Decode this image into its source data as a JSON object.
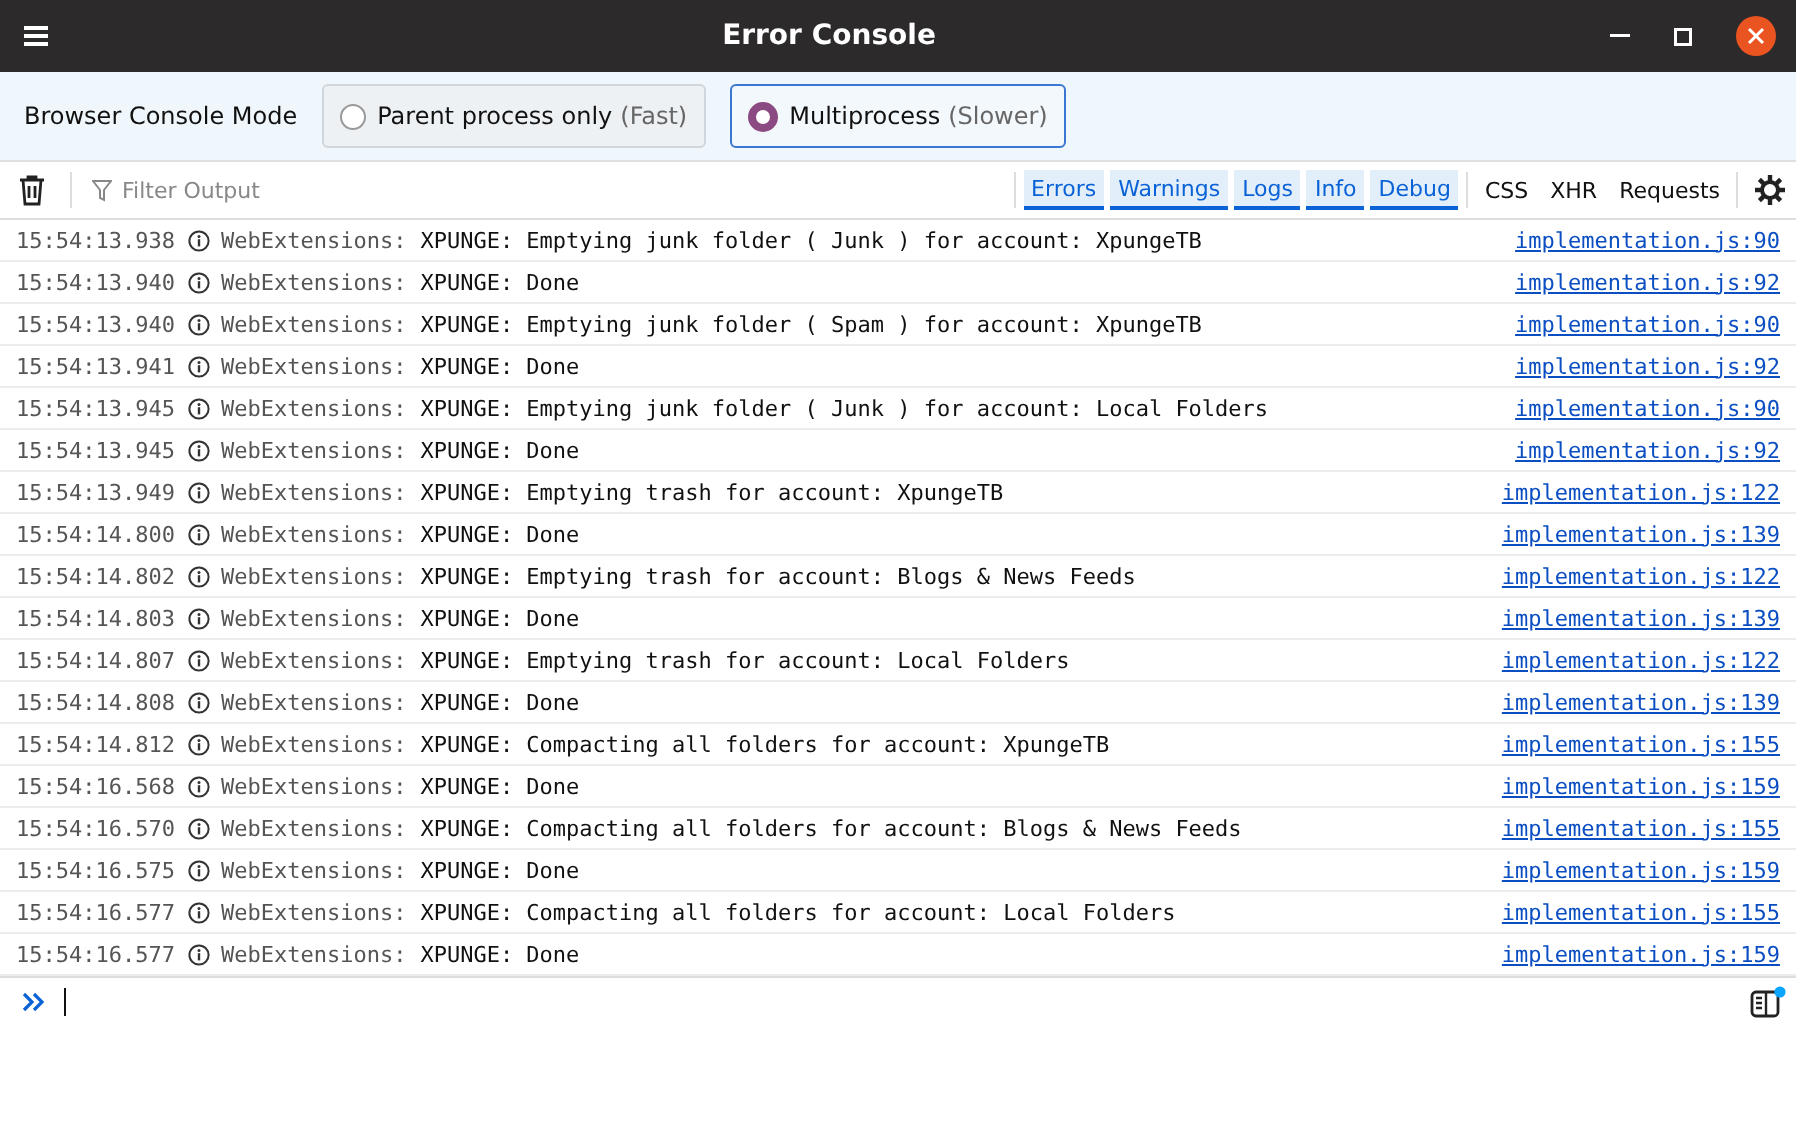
{
  "window": {
    "title": "Error Console"
  },
  "mode": {
    "label": "Browser Console Mode",
    "options": [
      {
        "label": "Parent process only",
        "note": "(Fast)",
        "selected": false
      },
      {
        "label": "Multiprocess",
        "note": "(Slower)",
        "selected": true
      }
    ]
  },
  "toolbar": {
    "filter_placeholder": "Filter Output",
    "filters": [
      {
        "label": "Errors",
        "selected": true
      },
      {
        "label": "Warnings",
        "selected": true
      },
      {
        "label": "Logs",
        "selected": true
      },
      {
        "label": "Info",
        "selected": true
      },
      {
        "label": "Debug",
        "selected": true
      },
      {
        "label": "CSS",
        "selected": false
      },
      {
        "label": "XHR",
        "selected": false
      },
      {
        "label": "Requests",
        "selected": false
      }
    ]
  },
  "messages": [
    {
      "time": "15:54:13.938",
      "source": "WebExtensions:",
      "text": "XPUNGE: Emptying junk folder ( Junk ) for account: XpungeTB",
      "location": "implementation.js:90"
    },
    {
      "time": "15:54:13.940",
      "source": "WebExtensions:",
      "text": "XPUNGE: Done",
      "location": "implementation.js:92"
    },
    {
      "time": "15:54:13.940",
      "source": "WebExtensions:",
      "text": "XPUNGE: Emptying junk folder ( Spam ) for account: XpungeTB",
      "location": "implementation.js:90"
    },
    {
      "time": "15:54:13.941",
      "source": "WebExtensions:",
      "text": "XPUNGE: Done",
      "location": "implementation.js:92"
    },
    {
      "time": "15:54:13.945",
      "source": "WebExtensions:",
      "text": "XPUNGE: Emptying junk folder ( Junk ) for account: Local Folders",
      "location": "implementation.js:90"
    },
    {
      "time": "15:54:13.945",
      "source": "WebExtensions:",
      "text": "XPUNGE: Done",
      "location": "implementation.js:92"
    },
    {
      "time": "15:54:13.949",
      "source": "WebExtensions:",
      "text": "XPUNGE: Emptying trash for account: XpungeTB",
      "location": "implementation.js:122"
    },
    {
      "time": "15:54:14.800",
      "source": "WebExtensions:",
      "text": "XPUNGE: Done",
      "location": "implementation.js:139"
    },
    {
      "time": "15:54:14.802",
      "source": "WebExtensions:",
      "text": "XPUNGE: Emptying trash for account: Blogs & News Feeds",
      "location": "implementation.js:122"
    },
    {
      "time": "15:54:14.803",
      "source": "WebExtensions:",
      "text": "XPUNGE: Done",
      "location": "implementation.js:139"
    },
    {
      "time": "15:54:14.807",
      "source": "WebExtensions:",
      "text": "XPUNGE: Emptying trash for account: Local Folders",
      "location": "implementation.js:122"
    },
    {
      "time": "15:54:14.808",
      "source": "WebExtensions:",
      "text": "XPUNGE: Done",
      "location": "implementation.js:139"
    },
    {
      "time": "15:54:14.812",
      "source": "WebExtensions:",
      "text": "XPUNGE: Compacting all folders for account: XpungeTB",
      "location": "implementation.js:155"
    },
    {
      "time": "15:54:16.568",
      "source": "WebExtensions:",
      "text": "XPUNGE: Done",
      "location": "implementation.js:159"
    },
    {
      "time": "15:54:16.570",
      "source": "WebExtensions:",
      "text": "XPUNGE: Compacting all folders for account: Blogs & News Feeds",
      "location": "implementation.js:155"
    },
    {
      "time": "15:54:16.575",
      "source": "WebExtensions:",
      "text": "XPUNGE: Done",
      "location": "implementation.js:159"
    },
    {
      "time": "15:54:16.577",
      "source": "WebExtensions:",
      "text": "XPUNGE: Compacting all folders for account: Local Folders",
      "location": "implementation.js:155"
    },
    {
      "time": "15:54:16.577",
      "source": "WebExtensions:",
      "text": "XPUNGE: Done",
      "location": "implementation.js:159"
    }
  ]
}
